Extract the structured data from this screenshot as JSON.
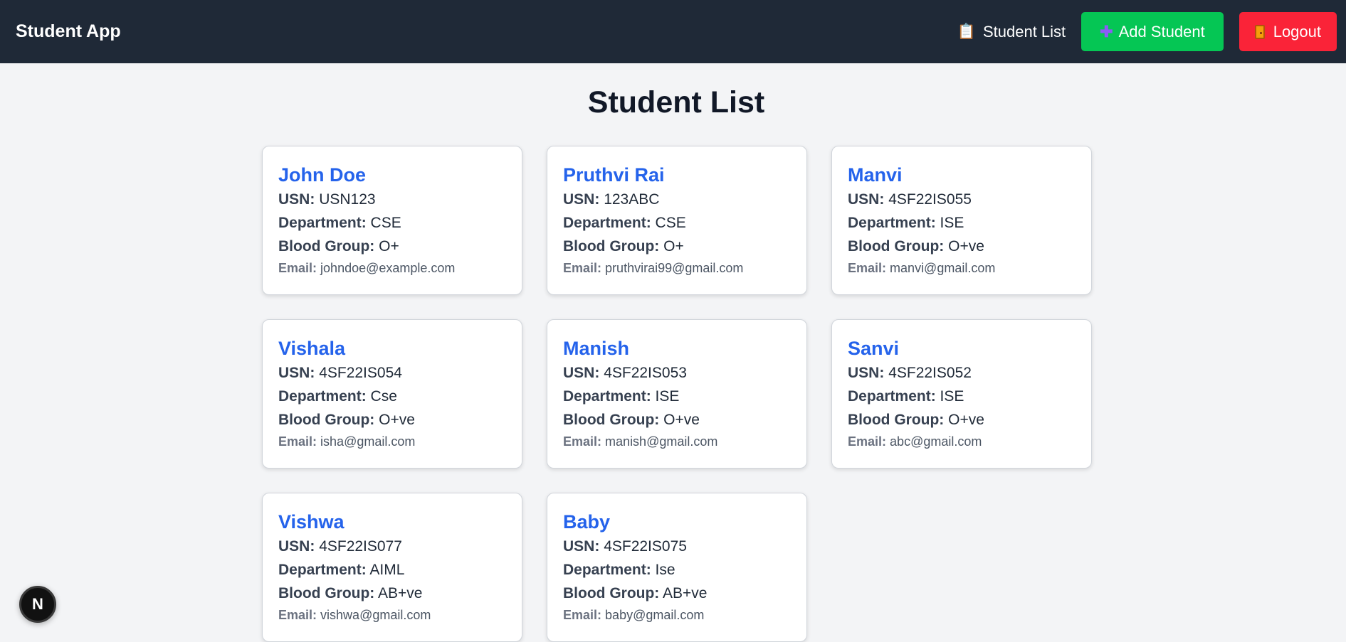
{
  "navbar": {
    "brand": "Student App",
    "student_list_icon": "clipboard-icon",
    "student_list_label": "Student List",
    "add_icon": "plus-icon",
    "add_label": "Add Student",
    "logout_icon": "door-icon",
    "logout_label": "Logout"
  },
  "page": {
    "title": "Student List"
  },
  "labels": {
    "usn": "USN:",
    "department": "Department:",
    "blood_group": "Blood Group:",
    "email": "Email:"
  },
  "students": [
    {
      "name": "John Doe",
      "usn": "USN123",
      "department": "CSE",
      "blood_group": "O+",
      "email": "johndoe@example.com"
    },
    {
      "name": "Pruthvi Rai",
      "usn": "123ABC",
      "department": "CSE",
      "blood_group": "O+",
      "email": "pruthvirai99@gmail.com"
    },
    {
      "name": "Manvi",
      "usn": "4SF22IS055",
      "department": "ISE",
      "blood_group": "O+ve",
      "email": "manvi@gmail.com"
    },
    {
      "name": "Vishala",
      "usn": "4SF22IS054",
      "department": "Cse",
      "blood_group": "O+ve",
      "email": "isha@gmail.com"
    },
    {
      "name": "Manish",
      "usn": "4SF22IS053",
      "department": "ISE",
      "blood_group": "O+ve",
      "email": "manish@gmail.com"
    },
    {
      "name": "Sanvi",
      "usn": "4SF22IS052",
      "department": "ISE",
      "blood_group": "O+ve",
      "email": "abc@gmail.com"
    },
    {
      "name": "Vishwa",
      "usn": "4SF22IS077",
      "department": "AIML",
      "blood_group": "AB+ve",
      "email": "vishwa@gmail.com"
    },
    {
      "name": "Baby",
      "usn": "4SF22IS075",
      "department": "Ise",
      "blood_group": "AB+ve",
      "email": "baby@gmail.com"
    }
  ],
  "dev_badge": {
    "letter": "N",
    "icon": "nextjs-icon"
  },
  "colors": {
    "navbar_bg": "#1f2937",
    "add_button": "#05c654",
    "logout_button": "#fa2338",
    "student_name": "#2563eb",
    "page_bg": "#f3f4f6"
  }
}
